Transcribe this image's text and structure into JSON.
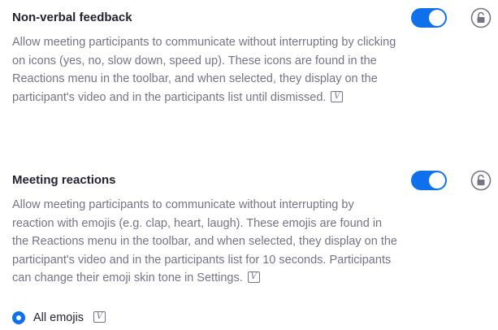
{
  "settings": [
    {
      "title": "Non-verbal feedback",
      "description": "Allow meeting participants to communicate without interrupting by clicking on icons (yes, no, slow down, speed up). These icons are found in the Reactions menu in the toolbar, and when selected, they display on the participant's video and in the participants list until dismissed.",
      "enabled": true,
      "badge": "V"
    },
    {
      "title": "Meeting reactions",
      "description": "Allow meeting participants to communicate without interrupting by reaction with emojis (e.g. clap, heart, laugh). These emojis are found in the Reactions menu in the toolbar, and when selected, they display on the participant's video and in the participants list for 10 seconds. Participants can change their emoji skin tone in Settings.",
      "enabled": true,
      "badge": "V"
    }
  ],
  "emoji_option": {
    "label": "All emojis",
    "selected": true,
    "badge": "V"
  },
  "colors": {
    "accent": "#0e71eb",
    "title_text": "#232333",
    "body_text": "#747487",
    "lock_icon": "#747487"
  },
  "icons": {
    "lock": "unlocked-padlock-icon",
    "version_badge": "v-badge-icon"
  }
}
